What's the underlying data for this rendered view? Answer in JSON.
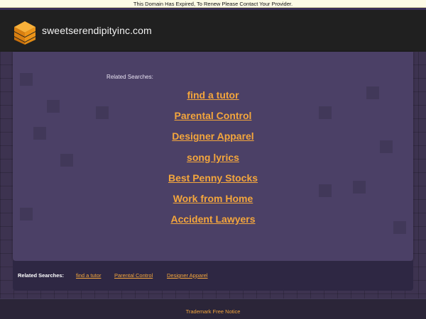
{
  "notice": "This Domain Has Expired, To Renew Please Contact Your Provider.",
  "header": {
    "site_name": "sweetserendipityinc.com",
    "logo_icon": "stacked-layers-icon",
    "logo_color": "#f39a1e"
  },
  "main": {
    "related_title": "Related Searches:",
    "links": [
      "find a tutor",
      "Parental Control",
      "Designer Apparel",
      "song lyrics",
      "Best Penny Stocks",
      "Work from Home",
      "Accident Lawyers"
    ]
  },
  "footer": {
    "label": "Related Searches:",
    "links": [
      "find a tutor",
      "Parental Control",
      "Designer Apparel"
    ]
  },
  "bottom": {
    "trademark": "Trademark Free Notice"
  },
  "colors": {
    "link": "#f4a63c",
    "header_bg": "#202020",
    "panel_bg": "#4b4066"
  }
}
